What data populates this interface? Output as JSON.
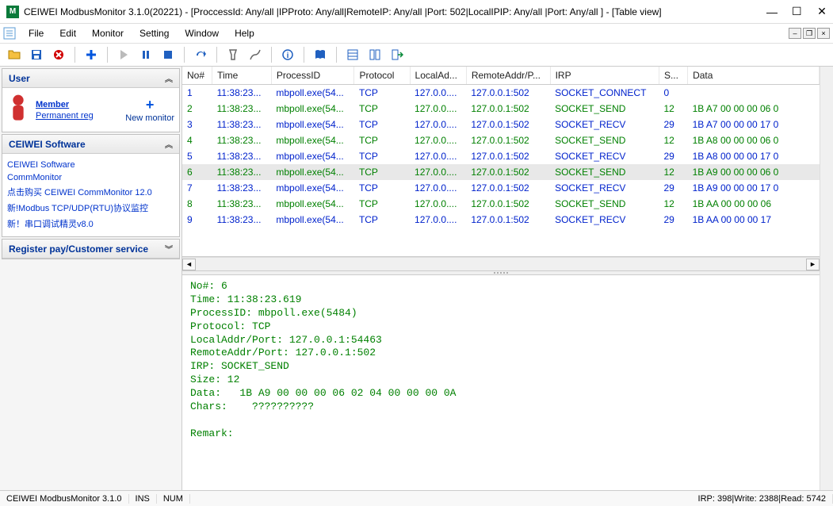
{
  "window": {
    "title": "CEIWEI ModbusMonitor 3.1.0(20221) - [ProccessId: Any/all |IPProto: Any/all|RemoteIP: Any/all |Port: 502|LocalIPIP: Any/all |Port: Any/all ] - [Table view]",
    "app_letter": "M"
  },
  "menu": {
    "file": "File",
    "edit": "Edit",
    "monitor": "Monitor",
    "setting": "Setting",
    "window": "Window",
    "help": "Help"
  },
  "sidebar": {
    "user_header": "User",
    "member": "Member",
    "permanent": "Permanent reg",
    "new_monitor": "New monitor",
    "software_header": "CEIWEI Software",
    "links": [
      "CEIWEI Software",
      "CommMonitor",
      "点击购买 CEIWEI CommMonitor 12.0",
      "新!Modbus TCP/UDP(RTU)协议监控",
      "新！串口调试精灵v8.0"
    ],
    "register_header": "Register pay/Customer service"
  },
  "table": {
    "columns": [
      "No#",
      "Time",
      "ProcessID",
      "Protocol",
      "LocalAd...",
      "RemoteAddr/P...",
      "IRP",
      "S...",
      "Data"
    ],
    "rows": [
      {
        "no": "1",
        "time": "11:38:23...",
        "proc": "mbpoll.exe(54...",
        "proto": "TCP",
        "local": "127.0.0....",
        "remote": "127.0.0.1:502",
        "irp": "SOCKET_CONNECT",
        "size": "0",
        "data": "",
        "cls": "row-blue"
      },
      {
        "no": "2",
        "time": "11:38:23...",
        "proc": "mbpoll.exe(54...",
        "proto": "TCP",
        "local": "127.0.0....",
        "remote": "127.0.0.1:502",
        "irp": "SOCKET_SEND",
        "size": "12",
        "data": "1B A7 00 00 00 06 0",
        "cls": "row-green"
      },
      {
        "no": "3",
        "time": "11:38:23...",
        "proc": "mbpoll.exe(54...",
        "proto": "TCP",
        "local": "127.0.0....",
        "remote": "127.0.0.1:502",
        "irp": "SOCKET_RECV",
        "size": "29",
        "data": "1B A7 00 00 00 17 0",
        "cls": "row-blue"
      },
      {
        "no": "4",
        "time": "11:38:23...",
        "proc": "mbpoll.exe(54...",
        "proto": "TCP",
        "local": "127.0.0....",
        "remote": "127.0.0.1:502",
        "irp": "SOCKET_SEND",
        "size": "12",
        "data": "1B A8 00 00 00 06 0",
        "cls": "row-green"
      },
      {
        "no": "5",
        "time": "11:38:23...",
        "proc": "mbpoll.exe(54...",
        "proto": "TCP",
        "local": "127.0.0....",
        "remote": "127.0.0.1:502",
        "irp": "SOCKET_RECV",
        "size": "29",
        "data": "1B A8 00 00 00 17 0",
        "cls": "row-blue"
      },
      {
        "no": "6",
        "time": "11:38:23...",
        "proc": "mbpoll.exe(54...",
        "proto": "TCP",
        "local": "127.0.0....",
        "remote": "127.0.0.1:502",
        "irp": "SOCKET_SEND",
        "size": "12",
        "data": "1B A9 00 00 00 06 0",
        "cls": "row-green selected"
      },
      {
        "no": "7",
        "time": "11:38:23...",
        "proc": "mbpoll.exe(54...",
        "proto": "TCP",
        "local": "127.0.0....",
        "remote": "127.0.0.1:502",
        "irp": "SOCKET_RECV",
        "size": "29",
        "data": "1B A9 00 00 00 17 0",
        "cls": "row-blue"
      },
      {
        "no": "8",
        "time": "11:38:23...",
        "proc": "mbpoll.exe(54...",
        "proto": "TCP",
        "local": "127.0.0....",
        "remote": "127.0.0.1:502",
        "irp": "SOCKET_SEND",
        "size": "12",
        "data": "1B AA 00 00 00 06 ",
        "cls": "row-green"
      },
      {
        "no": "9",
        "time": "11:38:23...",
        "proc": "mbpoll.exe(54...",
        "proto": "TCP",
        "local": "127.0.0....",
        "remote": "127.0.0.1:502",
        "irp": "SOCKET_RECV",
        "size": "29",
        "data": "1B AA 00 00 00 17 ",
        "cls": "row-blue"
      }
    ]
  },
  "detail": "No#: 6\nTime: 11:38:23.619\nProcessID: mbpoll.exe(5484)\nProtocol: TCP\nLocalAddr/Port: 127.0.0.1:54463\nRemoteAddr/Port: 127.0.0.1:502\nIRP: SOCKET_SEND\nSize: 12\nData:   1B A9 00 00 00 06 02 04 00 00 00 0A\nChars:    ??????????\n\nRemark:",
  "status": {
    "app": "CEIWEI ModbusMonitor 3.1.0",
    "ins": "INS",
    "num": "NUM",
    "counts": "IRP: 398|Write: 2388|Read: 5742"
  }
}
